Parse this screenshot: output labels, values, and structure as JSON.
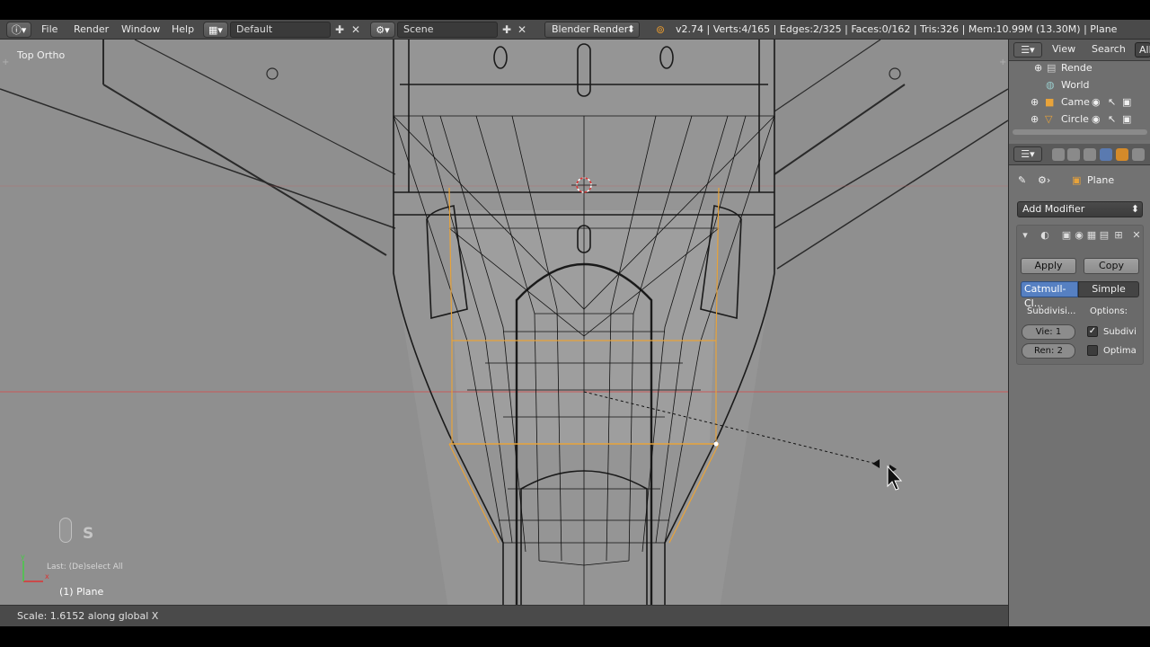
{
  "menu": {
    "file": "File",
    "render": "Render",
    "window": "Window",
    "help": "Help"
  },
  "layout": {
    "name": "Default"
  },
  "scene": {
    "name": "Scene"
  },
  "engine": {
    "name": "Blender Render"
  },
  "stats": "v2.74 | Verts:4/165 | Edges:2/325 | Faces:0/162 | Tris:326 | Mem:10.99M (13.30M) | Plane",
  "viewport": {
    "view_name": "Top Ortho",
    "object_label": "(1) Plane",
    "last_op": "Last: (De)select All",
    "key_pressed": "S"
  },
  "status": "Scale: 1.6152 along global X",
  "outliner": {
    "view_label": "View",
    "search_label": "Search",
    "filter_label": "All",
    "items": [
      {
        "label": "Rende",
        "icon": "render-layers-icon"
      },
      {
        "label": "World",
        "icon": "world-icon"
      },
      {
        "label": "Came",
        "icon": "camera-icon"
      },
      {
        "label": "Circle",
        "icon": "mesh-icon"
      }
    ]
  },
  "properties": {
    "object_name": "Plane",
    "add_modifier": "Add Modifier",
    "apply": "Apply",
    "copy": "Copy",
    "subdiv_type_active": "Catmull-Cl...",
    "subdiv_type_other": "Simple",
    "subdivisions_label": "Subdivisi...",
    "options_label": "Options:",
    "view_field": "Vie:",
    "view_value": "1",
    "render_field": "Ren:",
    "render_value": "2",
    "subdiv_uv_label": "Subdivi",
    "optimal_label": "Optima"
  },
  "colors": {
    "viewport_bg": "#8f8f8f",
    "wire": "#1a1a1a",
    "selected_wire": "#e8a33a",
    "x_axis": "#c85a5a",
    "active_tab": "#5680c2"
  }
}
